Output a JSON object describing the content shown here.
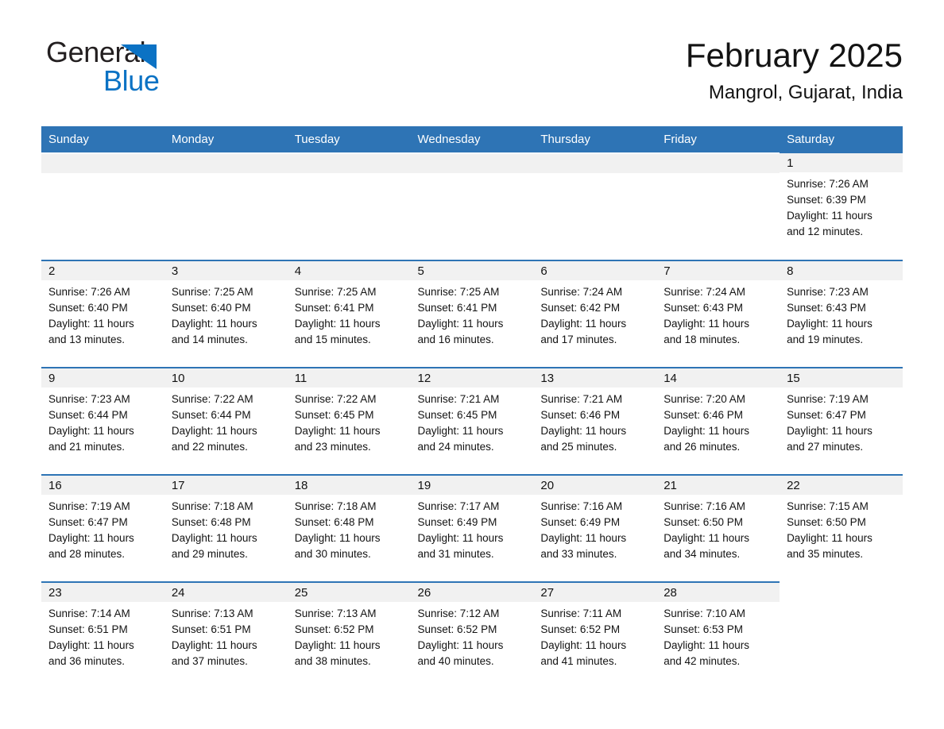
{
  "brand": {
    "name_part1": "General",
    "name_part2": "Blue",
    "triangle_color": "#0b72c4",
    "text_color": "#231f20"
  },
  "header": {
    "title": "February 2025",
    "subtitle": "Mangrol, Gujarat, India"
  },
  "theme": {
    "header_blue": "#2e74b5",
    "daynum_band": "#f1f1f1",
    "text": "#131313"
  },
  "weekdays": [
    "Sunday",
    "Monday",
    "Tuesday",
    "Wednesday",
    "Thursday",
    "Friday",
    "Saturday"
  ],
  "weeks": [
    [
      {
        "empty": true
      },
      {
        "empty": true
      },
      {
        "empty": true
      },
      {
        "empty": true
      },
      {
        "empty": true
      },
      {
        "empty": true
      },
      {
        "day": "1",
        "sunrise": "Sunrise: 7:26 AM",
        "sunset": "Sunset: 6:39 PM",
        "daylight1": "Daylight: 11 hours",
        "daylight2": "and 12 minutes."
      }
    ],
    [
      {
        "day": "2",
        "sunrise": "Sunrise: 7:26 AM",
        "sunset": "Sunset: 6:40 PM",
        "daylight1": "Daylight: 11 hours",
        "daylight2": "and 13 minutes."
      },
      {
        "day": "3",
        "sunrise": "Sunrise: 7:25 AM",
        "sunset": "Sunset: 6:40 PM",
        "daylight1": "Daylight: 11 hours",
        "daylight2": "and 14 minutes."
      },
      {
        "day": "4",
        "sunrise": "Sunrise: 7:25 AM",
        "sunset": "Sunset: 6:41 PM",
        "daylight1": "Daylight: 11 hours",
        "daylight2": "and 15 minutes."
      },
      {
        "day": "5",
        "sunrise": "Sunrise: 7:25 AM",
        "sunset": "Sunset: 6:41 PM",
        "daylight1": "Daylight: 11 hours",
        "daylight2": "and 16 minutes."
      },
      {
        "day": "6",
        "sunrise": "Sunrise: 7:24 AM",
        "sunset": "Sunset: 6:42 PM",
        "daylight1": "Daylight: 11 hours",
        "daylight2": "and 17 minutes."
      },
      {
        "day": "7",
        "sunrise": "Sunrise: 7:24 AM",
        "sunset": "Sunset: 6:43 PM",
        "daylight1": "Daylight: 11 hours",
        "daylight2": "and 18 minutes."
      },
      {
        "day": "8",
        "sunrise": "Sunrise: 7:23 AM",
        "sunset": "Sunset: 6:43 PM",
        "daylight1": "Daylight: 11 hours",
        "daylight2": "and 19 minutes."
      }
    ],
    [
      {
        "day": "9",
        "sunrise": "Sunrise: 7:23 AM",
        "sunset": "Sunset: 6:44 PM",
        "daylight1": "Daylight: 11 hours",
        "daylight2": "and 21 minutes."
      },
      {
        "day": "10",
        "sunrise": "Sunrise: 7:22 AM",
        "sunset": "Sunset: 6:44 PM",
        "daylight1": "Daylight: 11 hours",
        "daylight2": "and 22 minutes."
      },
      {
        "day": "11",
        "sunrise": "Sunrise: 7:22 AM",
        "sunset": "Sunset: 6:45 PM",
        "daylight1": "Daylight: 11 hours",
        "daylight2": "and 23 minutes."
      },
      {
        "day": "12",
        "sunrise": "Sunrise: 7:21 AM",
        "sunset": "Sunset: 6:45 PM",
        "daylight1": "Daylight: 11 hours",
        "daylight2": "and 24 minutes."
      },
      {
        "day": "13",
        "sunrise": "Sunrise: 7:21 AM",
        "sunset": "Sunset: 6:46 PM",
        "daylight1": "Daylight: 11 hours",
        "daylight2": "and 25 minutes."
      },
      {
        "day": "14",
        "sunrise": "Sunrise: 7:20 AM",
        "sunset": "Sunset: 6:46 PM",
        "daylight1": "Daylight: 11 hours",
        "daylight2": "and 26 minutes."
      },
      {
        "day": "15",
        "sunrise": "Sunrise: 7:19 AM",
        "sunset": "Sunset: 6:47 PM",
        "daylight1": "Daylight: 11 hours",
        "daylight2": "and 27 minutes."
      }
    ],
    [
      {
        "day": "16",
        "sunrise": "Sunrise: 7:19 AM",
        "sunset": "Sunset: 6:47 PM",
        "daylight1": "Daylight: 11 hours",
        "daylight2": "and 28 minutes."
      },
      {
        "day": "17",
        "sunrise": "Sunrise: 7:18 AM",
        "sunset": "Sunset: 6:48 PM",
        "daylight1": "Daylight: 11 hours",
        "daylight2": "and 29 minutes."
      },
      {
        "day": "18",
        "sunrise": "Sunrise: 7:18 AM",
        "sunset": "Sunset: 6:48 PM",
        "daylight1": "Daylight: 11 hours",
        "daylight2": "and 30 minutes."
      },
      {
        "day": "19",
        "sunrise": "Sunrise: 7:17 AM",
        "sunset": "Sunset: 6:49 PM",
        "daylight1": "Daylight: 11 hours",
        "daylight2": "and 31 minutes."
      },
      {
        "day": "20",
        "sunrise": "Sunrise: 7:16 AM",
        "sunset": "Sunset: 6:49 PM",
        "daylight1": "Daylight: 11 hours",
        "daylight2": "and 33 minutes."
      },
      {
        "day": "21",
        "sunrise": "Sunrise: 7:16 AM",
        "sunset": "Sunset: 6:50 PM",
        "daylight1": "Daylight: 11 hours",
        "daylight2": "and 34 minutes."
      },
      {
        "day": "22",
        "sunrise": "Sunrise: 7:15 AM",
        "sunset": "Sunset: 6:50 PM",
        "daylight1": "Daylight: 11 hours",
        "daylight2": "and 35 minutes."
      }
    ],
    [
      {
        "day": "23",
        "sunrise": "Sunrise: 7:14 AM",
        "sunset": "Sunset: 6:51 PM",
        "daylight1": "Daylight: 11 hours",
        "daylight2": "and 36 minutes."
      },
      {
        "day": "24",
        "sunrise": "Sunrise: 7:13 AM",
        "sunset": "Sunset: 6:51 PM",
        "daylight1": "Daylight: 11 hours",
        "daylight2": "and 37 minutes."
      },
      {
        "day": "25",
        "sunrise": "Sunrise: 7:13 AM",
        "sunset": "Sunset: 6:52 PM",
        "daylight1": "Daylight: 11 hours",
        "daylight2": "and 38 minutes."
      },
      {
        "day": "26",
        "sunrise": "Sunrise: 7:12 AM",
        "sunset": "Sunset: 6:52 PM",
        "daylight1": "Daylight: 11 hours",
        "daylight2": "and 40 minutes."
      },
      {
        "day": "27",
        "sunrise": "Sunrise: 7:11 AM",
        "sunset": "Sunset: 6:52 PM",
        "daylight1": "Daylight: 11 hours",
        "daylight2": "and 41 minutes."
      },
      {
        "day": "28",
        "sunrise": "Sunrise: 7:10 AM",
        "sunset": "Sunset: 6:53 PM",
        "daylight1": "Daylight: 11 hours",
        "daylight2": "and 42 minutes."
      },
      {
        "empty": true
      }
    ]
  ]
}
